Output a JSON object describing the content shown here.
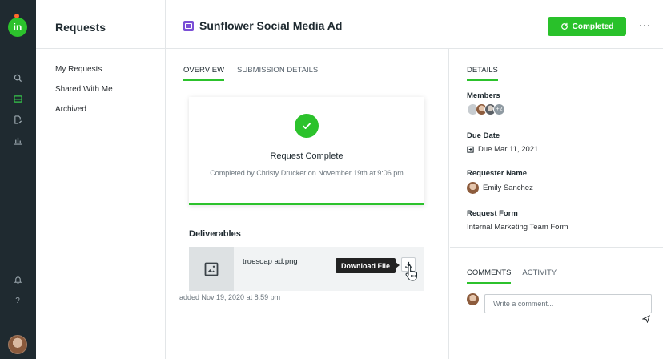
{
  "app": {
    "logo_text": "in",
    "section_title": "Requests"
  },
  "subnav": {
    "items": [
      {
        "label": "My Requests"
      },
      {
        "label": "Shared With Me"
      },
      {
        "label": "Archived"
      }
    ]
  },
  "header": {
    "title": "Sunflower Social Media Ad",
    "status_label": "Completed",
    "more_label": "···"
  },
  "main": {
    "tabs": [
      {
        "label": "OVERVIEW",
        "active": true
      },
      {
        "label": "SUBMISSION DETAILS",
        "active": false
      }
    ],
    "card": {
      "title": "Request Complete",
      "subtitle": "Completed by Christy Drucker on November 19th at 9:06 pm"
    },
    "deliverables": {
      "title": "Deliverables",
      "file_name": "truesoap ad.png",
      "tooltip": "Download File",
      "added_text": "added Nov 19, 2020 at 8:59 pm"
    }
  },
  "side": {
    "tab": "DETAILS",
    "members_label": "Members",
    "members_more": "+2",
    "due_label": "Due Date",
    "due_value": "Due Mar 11, 2021",
    "requester_label": "Requester Name",
    "requester_value": "Emily Sanchez",
    "form_label": "Request Form",
    "form_value": "Internal Marketing Team Form",
    "comment_tabs": [
      {
        "label": "COMMENTS",
        "active": true
      },
      {
        "label": "ACTIVITY",
        "active": false
      }
    ],
    "comment_placeholder": "Write a comment..."
  },
  "colors": {
    "accent_green": "#2cc22c",
    "rail_dark": "#1f2a30",
    "request_icon_purple": "#7b4fd6"
  },
  "icons": {
    "rail": [
      "search-icon",
      "inbox-icon",
      "edit-document-icon",
      "chart-icon",
      "bell-icon",
      "help-icon"
    ]
  }
}
